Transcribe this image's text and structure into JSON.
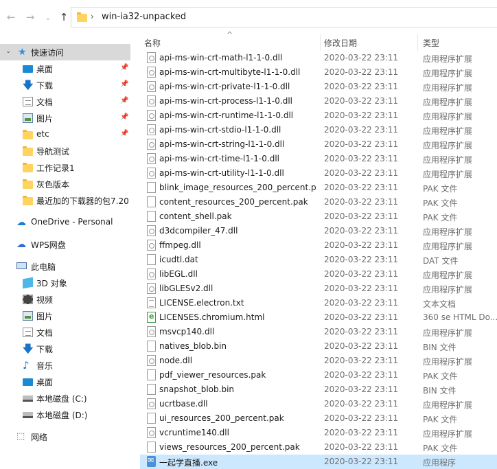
{
  "address": {
    "back": "←",
    "forward": "→",
    "dropdown": "⌄",
    "up": "↑",
    "separator": "›",
    "path": "win-ia32-unpacked"
  },
  "sidebar": {
    "quick_access": "快速访问",
    "pinned": [
      {
        "label": "桌面",
        "icon": "desktop-icon"
      },
      {
        "label": "下载",
        "icon": "download-icon"
      },
      {
        "label": "文档",
        "icon": "document-icon"
      },
      {
        "label": "图片",
        "icon": "picture-icon"
      },
      {
        "label": "etc",
        "icon": "folder-icon"
      }
    ],
    "recent": [
      "导航测试",
      "工作记录1",
      "灰色版本",
      "最近加的下载器的包7.20"
    ],
    "onedrive": "OneDrive - Personal",
    "wps": "WPS网盘",
    "this_pc": "此电脑",
    "pc_items": [
      {
        "label": "3D 对象",
        "icon": "3d-objects-icon"
      },
      {
        "label": "视频",
        "icon": "video-icon"
      },
      {
        "label": "图片",
        "icon": "picture-icon"
      },
      {
        "label": "文档",
        "icon": "document-icon"
      },
      {
        "label": "下载",
        "icon": "download-icon"
      },
      {
        "label": "音乐",
        "icon": "music-icon"
      },
      {
        "label": "桌面",
        "icon": "desktop-icon"
      },
      {
        "label": "本地磁盘 (C:)",
        "icon": "drive-icon"
      },
      {
        "label": "本地磁盘 (D:)",
        "icon": "drive-icon"
      }
    ],
    "network": "网络"
  },
  "columns": {
    "name": "名称",
    "date": "修改日期",
    "type": "类型",
    "sort_arrow": "^"
  },
  "files": [
    {
      "name": "api-ms-win-crt-math-l1-1-0.dll",
      "date": "2020-03-22 23:11",
      "type": "应用程序扩展",
      "kind": "dll"
    },
    {
      "name": "api-ms-win-crt-multibyte-l1-1-0.dll",
      "date": "2020-03-22 23:11",
      "type": "应用程序扩展",
      "kind": "dll"
    },
    {
      "name": "api-ms-win-crt-private-l1-1-0.dll",
      "date": "2020-03-22 23:11",
      "type": "应用程序扩展",
      "kind": "dll"
    },
    {
      "name": "api-ms-win-crt-process-l1-1-0.dll",
      "date": "2020-03-22 23:11",
      "type": "应用程序扩展",
      "kind": "dll"
    },
    {
      "name": "api-ms-win-crt-runtime-l1-1-0.dll",
      "date": "2020-03-22 23:11",
      "type": "应用程序扩展",
      "kind": "dll"
    },
    {
      "name": "api-ms-win-crt-stdio-l1-1-0.dll",
      "date": "2020-03-22 23:11",
      "type": "应用程序扩展",
      "kind": "dll"
    },
    {
      "name": "api-ms-win-crt-string-l1-1-0.dll",
      "date": "2020-03-22 23:11",
      "type": "应用程序扩展",
      "kind": "dll"
    },
    {
      "name": "api-ms-win-crt-time-l1-1-0.dll",
      "date": "2020-03-22 23:11",
      "type": "应用程序扩展",
      "kind": "dll"
    },
    {
      "name": "api-ms-win-crt-utility-l1-1-0.dll",
      "date": "2020-03-22 23:11",
      "type": "应用程序扩展",
      "kind": "dll"
    },
    {
      "name": "blink_image_resources_200_percent.p...",
      "date": "2020-03-22 23:11",
      "type": "PAK 文件",
      "kind": "file"
    },
    {
      "name": "content_resources_200_percent.pak",
      "date": "2020-03-22 23:11",
      "type": "PAK 文件",
      "kind": "file"
    },
    {
      "name": "content_shell.pak",
      "date": "2020-03-22 23:11",
      "type": "PAK 文件",
      "kind": "file"
    },
    {
      "name": "d3dcompiler_47.dll",
      "date": "2020-03-22 23:11",
      "type": "应用程序扩展",
      "kind": "dll"
    },
    {
      "name": "ffmpeg.dll",
      "date": "2020-03-22 23:11",
      "type": "应用程序扩展",
      "kind": "dll"
    },
    {
      "name": "icudtl.dat",
      "date": "2020-03-22 23:11",
      "type": "DAT 文件",
      "kind": "file"
    },
    {
      "name": "libEGL.dll",
      "date": "2020-03-22 23:11",
      "type": "应用程序扩展",
      "kind": "dll"
    },
    {
      "name": "libGLESv2.dll",
      "date": "2020-03-22 23:11",
      "type": "应用程序扩展",
      "kind": "dll"
    },
    {
      "name": "LICENSE.electron.txt",
      "date": "2020-03-22 23:11",
      "type": "文本文档",
      "kind": "txt"
    },
    {
      "name": "LICENSES.chromium.html",
      "date": "2020-03-22 23:11",
      "type": "360 se HTML Do...",
      "kind": "html"
    },
    {
      "name": "msvcp140.dll",
      "date": "2020-03-22 23:11",
      "type": "应用程序扩展",
      "kind": "dll"
    },
    {
      "name": "natives_blob.bin",
      "date": "2020-03-22 23:11",
      "type": "BIN 文件",
      "kind": "file"
    },
    {
      "name": "node.dll",
      "date": "2020-03-22 23:11",
      "type": "应用程序扩展",
      "kind": "dll"
    },
    {
      "name": "pdf_viewer_resources.pak",
      "date": "2020-03-22 23:11",
      "type": "PAK 文件",
      "kind": "file"
    },
    {
      "name": "snapshot_blob.bin",
      "date": "2020-03-22 23:11",
      "type": "BIN 文件",
      "kind": "file"
    },
    {
      "name": "ucrtbase.dll",
      "date": "2020-03-22 23:11",
      "type": "应用程序扩展",
      "kind": "dll"
    },
    {
      "name": "ui_resources_200_percent.pak",
      "date": "2020-03-22 23:11",
      "type": "PAK 文件",
      "kind": "file"
    },
    {
      "name": "vcruntime140.dll",
      "date": "2020-03-22 23:11",
      "type": "应用程序扩展",
      "kind": "dll"
    },
    {
      "name": "views_resources_200_percent.pak",
      "date": "2020-03-22 23:11",
      "type": "PAK 文件",
      "kind": "file"
    },
    {
      "name": "一起学直播.exe",
      "date": "2020-03-22 23:11",
      "type": "应用程序",
      "kind": "exe",
      "selected": true
    }
  ]
}
